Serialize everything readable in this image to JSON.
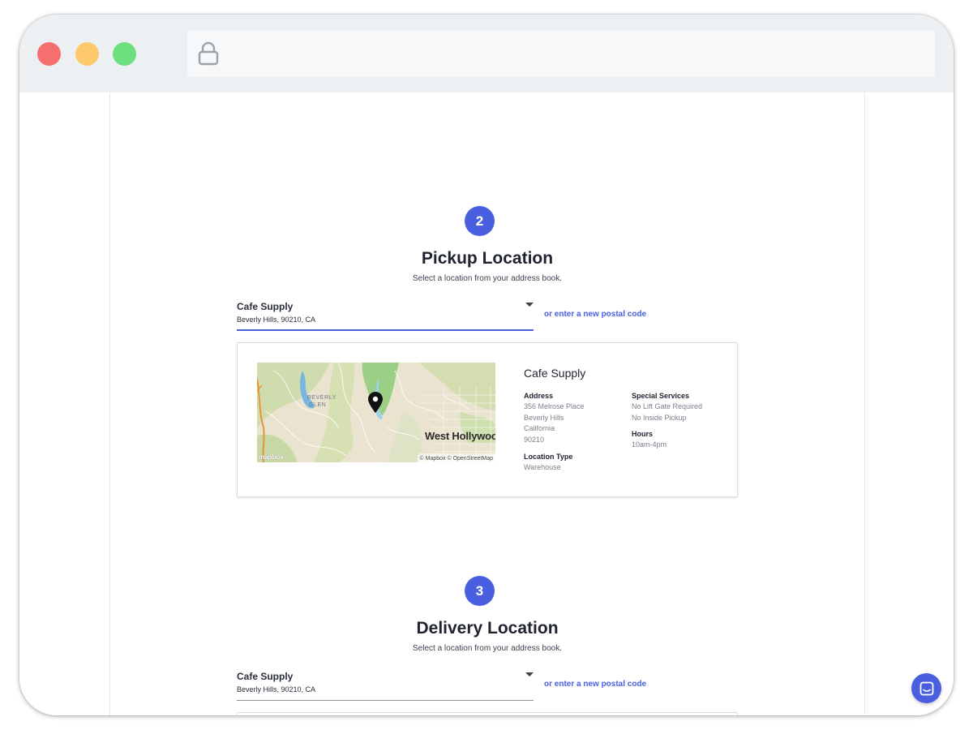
{
  "pickup": {
    "step": "2",
    "title": "Pickup Location",
    "subtitle": "Select a location from your address book.",
    "selected_name": "Cafe Supply",
    "selected_address": "Beverly Hills, 90210, CA",
    "postal_link": "or enter a new postal code",
    "card": {
      "name": "Cafe Supply",
      "address_label": "Address",
      "address_lines": [
        "356 Melrose Place",
        "Beverly Hills",
        "California",
        "90210"
      ],
      "location_type_label": "Location Type",
      "location_type": "Warehouse",
      "special_services_label": "Special Services",
      "special_services": [
        "No Lift Gate Required",
        "No Inside Pickup"
      ],
      "hours_label": "Hours",
      "hours": "10am-4pm",
      "map": {
        "city_label": "West Hollywood",
        "neighborhood_label": [
          "BEVERLY",
          "GLEN"
        ],
        "attribution": "© Mapbox © OpenStreetMap",
        "logo_text": "mapbox"
      }
    }
  },
  "delivery": {
    "step": "3",
    "title": "Delivery Location",
    "subtitle": "Select a location from your address book.",
    "selected_name": "Cafe Supply",
    "selected_address": "Beverly Hills, 90210, CA",
    "postal_link": "or enter a new postal code"
  },
  "colors": {
    "accent": "#4a5fe0",
    "traffic_red": "#f76e6e",
    "traffic_yellow": "#fdc96b",
    "traffic_green": "#6ce07f"
  },
  "icons": {
    "lock": "lock-icon",
    "map_pin": "map-pin-icon",
    "dropdown": "chevron-down-icon",
    "chat": "chat-icon"
  }
}
